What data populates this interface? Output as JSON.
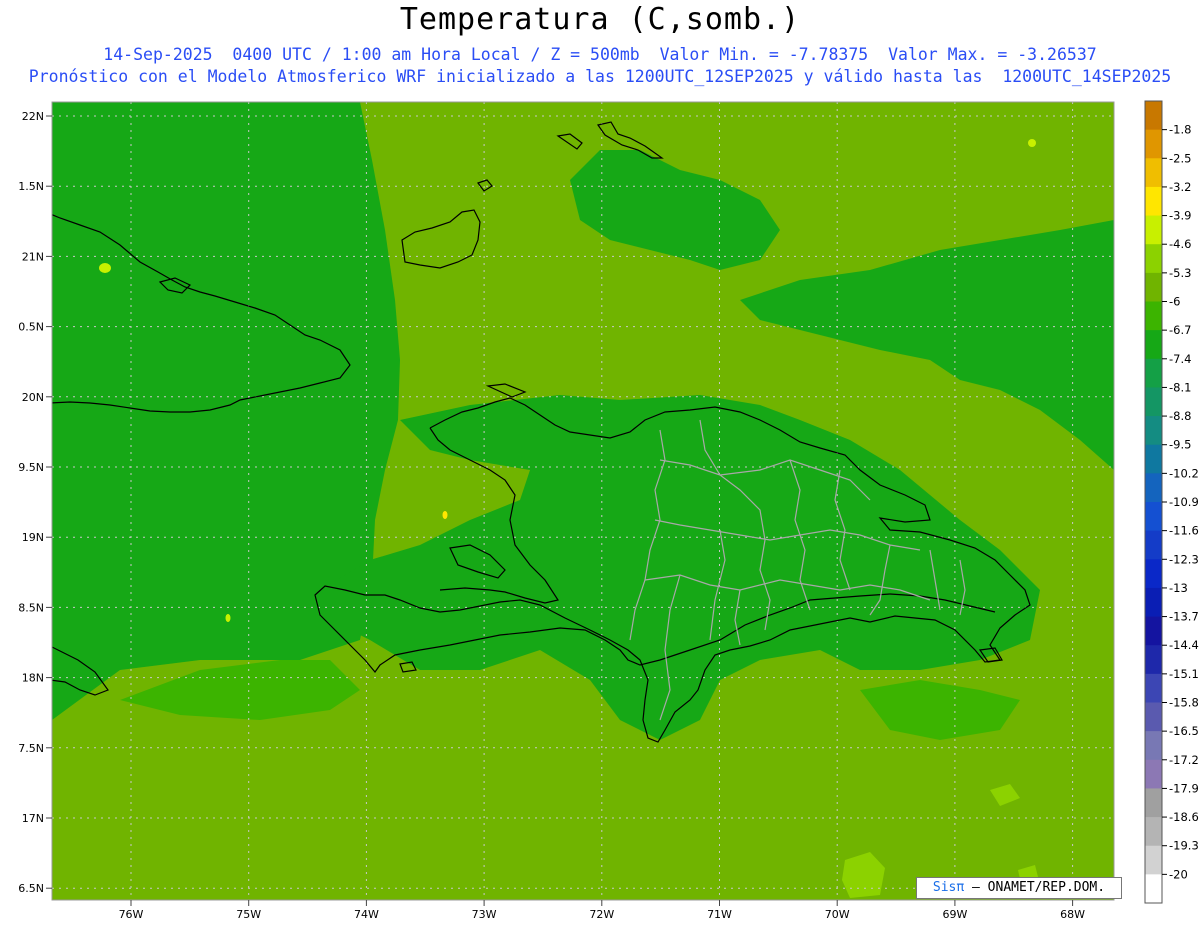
{
  "header": {
    "title": "Temperatura (C,somb.)",
    "subtitle_line1": "14-Sep-2025  0400 UTC / 1:00 am Hora Local / Z = 500mb  Valor Min. = -7.78375  Valor Max. = -3.26537",
    "subtitle_line2": "Pronóstico con el Modelo Atmosferico WRF inicializado a las 1200UTC_12SEP2025 y válido hasta las  1200UTC_14SEP2025"
  },
  "map": {
    "lat_labels": [
      "22N",
      "1.5N",
      "21N",
      "0.5N",
      "20N",
      "9.5N",
      "19N",
      "8.5N",
      "18N",
      "7.5N",
      "17N",
      "6.5N"
    ],
    "lon_labels": [
      "76W",
      "75W",
      "74W",
      "73W",
      "72W",
      "71W",
      "70W",
      "69W",
      "68W"
    ],
    "field_colors": {
      "base": "#70b400",
      "mid": "#3cb400",
      "dark": "#16a816",
      "light": "#8cd200"
    },
    "coast_color": "#000000",
    "province_color": "#a8a8a8"
  },
  "colorbar": {
    "labels": [
      "-1.8",
      "-2.5",
      "-3.2",
      "-3.9",
      "-4.6",
      "-5.3",
      "-6",
      "-6.7",
      "-7.4",
      "-8.1",
      "-8.8",
      "-9.5",
      "-10.2",
      "-10.9",
      "-11.6",
      "-12.3",
      "-13",
      "-13.7",
      "-14.4",
      "-15.1",
      "-15.8",
      "-16.5",
      "-17.2",
      "-17.9",
      "-18.6",
      "-19.3",
      "-20"
    ],
    "colors": [
      "#c87800",
      "#e09600",
      "#f0be00",
      "#ffe600",
      "#c8f000",
      "#8cd200",
      "#70b400",
      "#3cb400",
      "#16a816",
      "#14a046",
      "#149664",
      "#148c82",
      "#0f78a0",
      "#1464be",
      "#1450d2",
      "#143cc8",
      "#0a28c8",
      "#0a1eb4",
      "#1414a0",
      "#1e28aa",
      "#3c46b4",
      "#5a5aaf",
      "#7878b4",
      "#8c78b4",
      "#a0a0a0",
      "#b4b4b4",
      "#d2d2d2",
      "#ffffff"
    ]
  },
  "credit": {
    "brand": "Sisπ",
    "text": "– ONAMET/REP.DOM."
  }
}
